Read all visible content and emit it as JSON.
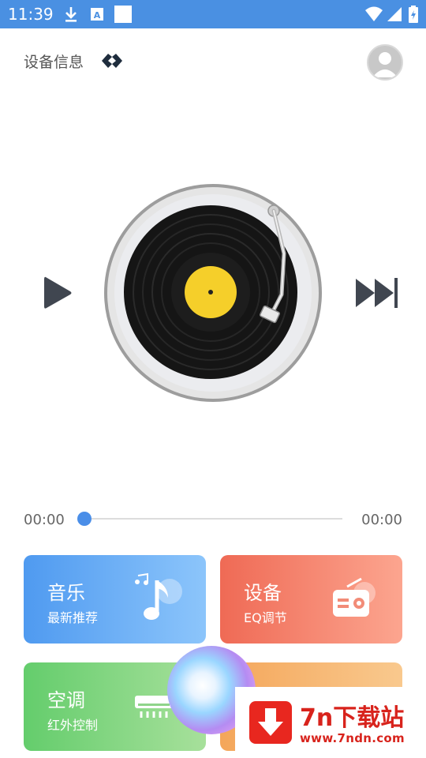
{
  "status_bar": {
    "time": "11:39",
    "icons": [
      "download-icon",
      "a-icon",
      "blank-notification-icon",
      "wifi-icon",
      "signal-icon",
      "battery-icon"
    ],
    "color": "#4a90e2"
  },
  "header": {
    "device_info_label": "设备信息",
    "device_logo_icon": "diamond-link-icon",
    "avatar_icon": "user-avatar-icon"
  },
  "player": {
    "play_icon": "play-icon",
    "next_icon": "skip-next-icon",
    "turntable_icon": "vinyl-record-icon",
    "progress_fraction": 0,
    "time_current": "00:00",
    "time_total": "00:00",
    "accent_color": "#4a8ee8"
  },
  "cards": [
    {
      "title": "音乐",
      "subtitle": "最新推荐",
      "icon": "music-note-icon",
      "color": "#4f9af0"
    },
    {
      "title": "设备",
      "subtitle": "EQ调节",
      "icon": "radio-icon",
      "color": "#ef6a55"
    },
    {
      "title": "空调",
      "subtitle": "红外控制",
      "icon": "air-conditioner-icon",
      "color": "#64cd6c"
    },
    {
      "title": "",
      "subtitle": "",
      "icon": "",
      "color": "#f4a65a"
    }
  ],
  "overlay": {
    "assistant_orb_icon": "assistant-orb-icon",
    "watermark_title": "7n下载站",
    "watermark_url": "www.7ndn.com",
    "watermark_color": "#d8231c"
  }
}
